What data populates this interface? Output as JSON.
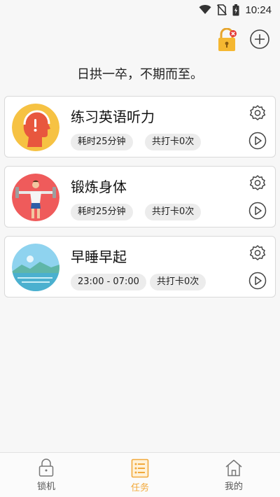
{
  "status_bar": {
    "time": "10:24",
    "icons": [
      "wifi-icon",
      "no-sim-icon",
      "battery-icon"
    ]
  },
  "toolbar": {
    "lock_icon": "lock-alert-icon",
    "add_icon": "add-circle-icon"
  },
  "motto": "日拱一卒，不期而至。",
  "tasks": [
    {
      "title": "练习英语听力",
      "chip1": "耗时25分钟",
      "chip2": "共打卡0次",
      "avatar": "headphones-head-avatar",
      "avatar_color": "#f6c243"
    },
    {
      "title": "锻炼身体",
      "chip1": "耗时25分钟",
      "chip2": "共打卡0次",
      "avatar": "dumbbell-man-avatar",
      "avatar_color": "#ef5b5b"
    },
    {
      "title": "早睡早起",
      "chip1": "23:00 - 07:00",
      "chip2": "共打卡0次",
      "avatar": "lake-landscape-avatar",
      "avatar_color": "#8fd3ef"
    }
  ],
  "tabs": [
    {
      "label": "锁机",
      "icon": "lock-icon",
      "active": false
    },
    {
      "label": "任务",
      "icon": "task-list-icon",
      "active": true
    },
    {
      "label": "我的",
      "icon": "home-icon",
      "active": false
    }
  ],
  "colors": {
    "accent": "#f2a93b",
    "background": "#f7f7f7",
    "card": "#ffffff"
  }
}
